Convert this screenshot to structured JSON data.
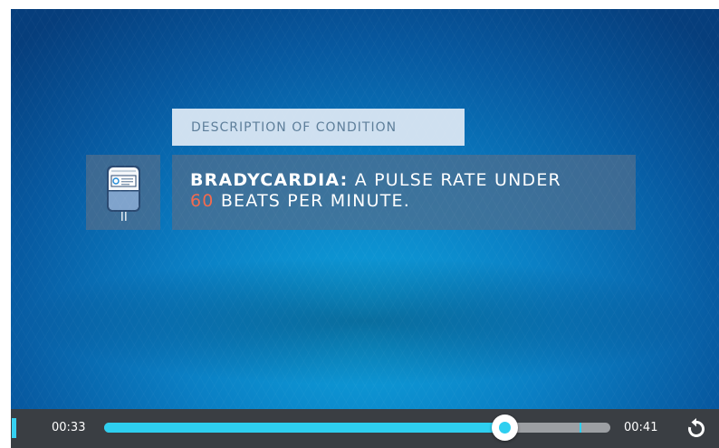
{
  "slide": {
    "section_label": "DESCRIPTION OF CONDITION",
    "term": "BRADYCARDIA:",
    "line1_rest": " A PULSE RATE UNDER",
    "number": "60",
    "line2_rest": " BEATS PER MINUTE.",
    "icon": "iv-bag-icon",
    "highlight_color": "#f26a4f"
  },
  "controls": {
    "current_time": "00:33",
    "total_time": "00:41",
    "progress_fraction": 0.79,
    "buffered_marker_fraction": 0.94,
    "play_icon": "play-pause-icon",
    "replay_icon": "replay-icon",
    "accent_color": "#2ecff0"
  }
}
